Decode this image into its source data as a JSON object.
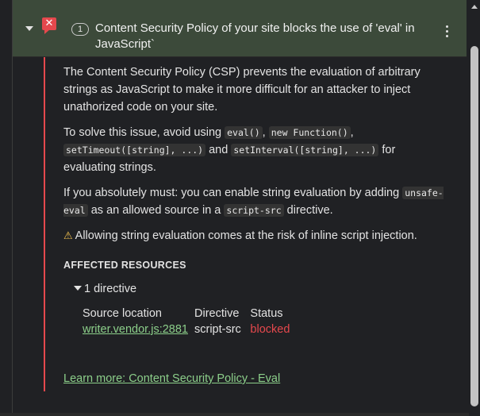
{
  "issue": {
    "count": "1",
    "title": "Content Security Policy of your site blocks the use of 'eval' in JavaScript`",
    "paragraph1": "The Content Security Policy (CSP) prevents the evaluation of arbitrary strings as JavaScript to make it more difficult for an attacker to inject unathorized code on your site.",
    "p2_a": "To solve this issue, avoid using ",
    "p2_code1": "eval()",
    "p2_b": ", ",
    "p2_code2": "new Function()",
    "p2_c": ", ",
    "p2_code3": "setTimeout([string], ...)",
    "p2_d": " and ",
    "p2_code4": "setInterval([string], ...)",
    "p2_e": " for evaluating strings.",
    "p3_a": "If you absolutely must: you can enable string evaluation by adding ",
    "p3_code1": "unsafe-eval",
    "p3_b": " as an allowed source in a ",
    "p3_code2": "script-src",
    "p3_c": " directive.",
    "warning": "Allowing string evaluation comes at the risk of inline script injection.",
    "affected_heading": "AFFECTED RESOURCES",
    "directive_toggle": "1 directive",
    "table": {
      "headers": [
        "Source location",
        "Directive",
        "Status"
      ],
      "row": {
        "source": "writer.vendor.js:2881",
        "directive": "script-src",
        "status": "blocked"
      }
    },
    "learn_more": "Learn more: Content Security Policy - Eval"
  },
  "icons": {
    "collapse": "caret-down-icon",
    "issue_type": "error-flag-icon",
    "menu": "kebab-menu-icon",
    "warning": "warning-triangle-icon"
  },
  "colors": {
    "header_bg": "#3c4a3a",
    "error_red": "#e5484d",
    "link_green": "#8ccf8a",
    "warning_yellow": "#f2c14e"
  }
}
